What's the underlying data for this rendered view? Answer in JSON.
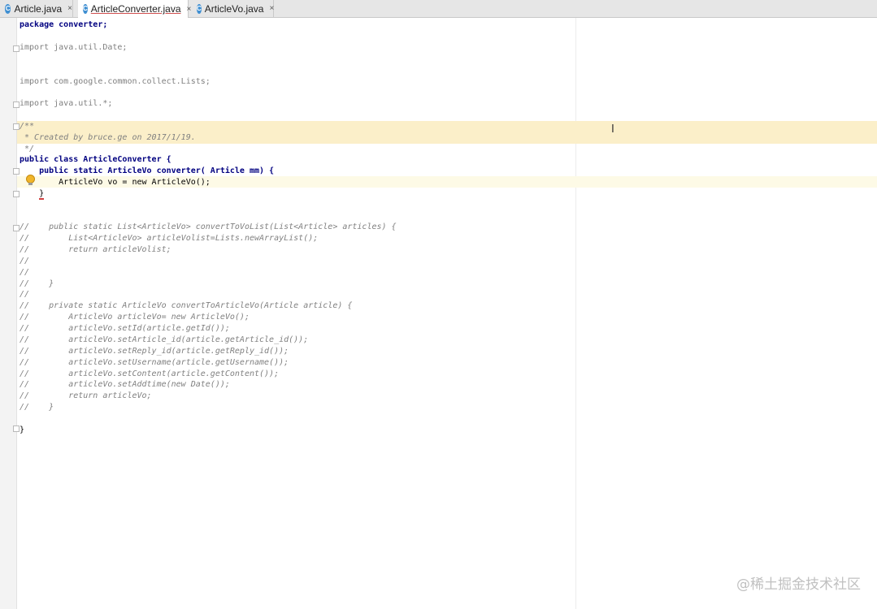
{
  "tabs": [
    {
      "icon": "class-icon",
      "label": "Article.java",
      "close": "×"
    },
    {
      "icon": "class-icon",
      "label": "ArticleConverter.java",
      "close": "×"
    },
    {
      "icon": "class-icon",
      "label": "ArticleVo.java",
      "close": "×"
    }
  ],
  "tab_icon_letter": "C",
  "code": {
    "l1": "package converter;",
    "l2": "import java.util.Date;",
    "l3": "import com.google.common.collect.Lists;",
    "l4": "import java.util.*;",
    "c1": "/**",
    "c2": " * Created by bruce.ge on 2017/1/19.",
    "c3": " */",
    "l5": "public class ArticleConverter {",
    "l6": "    public static ArticleVo converter( Article mm) {",
    "l7": "        ArticleVo vo = new ArticleVo();",
    "l8": "    }",
    "d1": "//    public static List<ArticleVo> convertToVoList(List<Article> articles) {",
    "d2": "//        List<ArticleVo> articleVolist=Lists.newArrayList();",
    "d3": "//        return articleVolist;",
    "d4": "//",
    "d5": "//",
    "d6": "//    }",
    "d7": "//",
    "d8": "//    private static ArticleVo convertToArticleVo(Article article) {",
    "d9": "//        ArticleVo articleVo= new ArticleVo();",
    "d10": "//        articleVo.setId(article.getId());",
    "d11": "//        articleVo.setArticle_id(article.getArticle_id());",
    "d12": "//        articleVo.setReply_id(article.getReply_id());",
    "d13": "//        articleVo.setUsername(article.getUsername());",
    "d14": "//        articleVo.setContent(article.getContent());",
    "d15": "//        articleVo.setAddtime(new Date());",
    "d16": "//        return articleVo;",
    "d17": "//    }",
    "l9": "}"
  },
  "watermark": "@稀土掘金技术社区",
  "colors": {
    "keyword": "#000080",
    "comment": "#808080",
    "doc_highlight": "#fbefc9",
    "tab_active": "#ffffff"
  }
}
